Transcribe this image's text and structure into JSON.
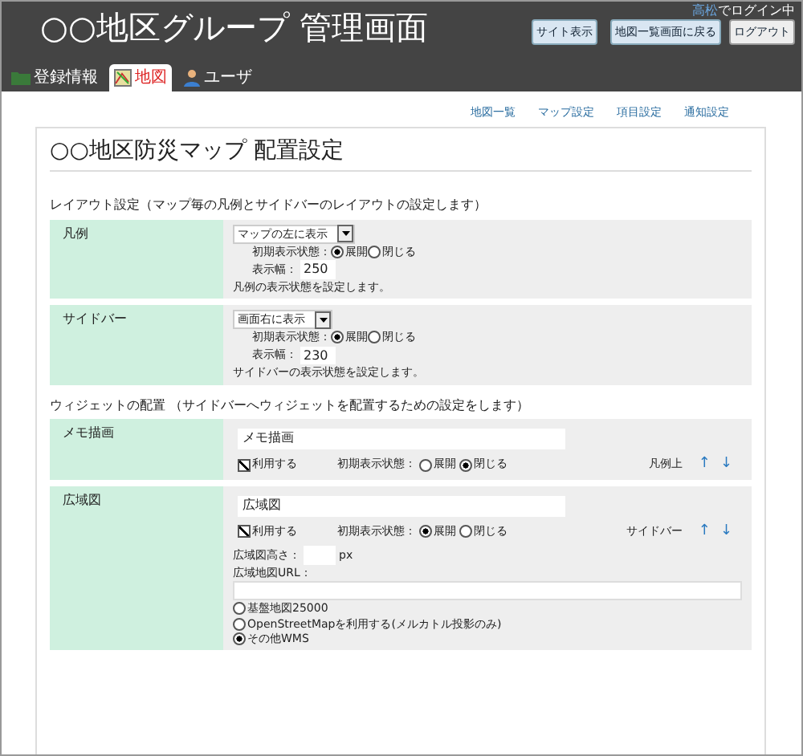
{
  "header": {
    "title": "○○地区グループ 管理画面",
    "login": {
      "user": "高松",
      "suffix": "でログイン中"
    },
    "buttons": [
      "サイト表示",
      "地図一覧画面に戻る",
      "ログアウト"
    ]
  },
  "tabs": [
    {
      "label": "登録情報",
      "selected": false
    },
    {
      "label": "地図",
      "selected": true
    },
    {
      "label": "ユーザ",
      "selected": false
    }
  ],
  "submenu": [
    "地図一覧",
    "マップ設定",
    "項目設定",
    "通知設定"
  ],
  "page_title": "○○地区防災マップ 配置設定",
  "sections": [
    {
      "heading": "レイアウト設定（マップ毎の凡例とサイドバーのレイアウトの設定します）",
      "rows": [
        {
          "kind": "layout",
          "label": "凡例",
          "select": "マップの左に表示",
          "state_label": "初期表示状態：",
          "options": [
            {
              "label": "展開",
              "selected": true
            },
            {
              "label": "閉じる",
              "selected": false
            }
          ],
          "width_label": "表示幅：",
          "width_value": "250",
          "note": "凡例の表示状態を設定します。"
        },
        {
          "kind": "layout",
          "label": "サイドバー",
          "select": "画面右に表示",
          "state_label": "初期表示状態：",
          "options": [
            {
              "label": "展開",
              "selected": true
            },
            {
              "label": "閉じる",
              "selected": false
            }
          ],
          "width_label": "表示幅：",
          "width_value": "230",
          "note": "サイドバーの表示状態を設定します。"
        }
      ]
    },
    {
      "heading": "ウィジェットの配置 （サイドバーへウィジェットを配置するための設定をします）",
      "rows": [
        {
          "kind": "widget",
          "label": "メモ描画",
          "name": "メモ描画",
          "use": {
            "label": "利用する",
            "checked": true
          },
          "state_label": "初期表示状態：",
          "options": [
            {
              "label": "展開",
              "selected": false
            },
            {
              "label": "閉じる",
              "selected": true
            }
          ],
          "position": "凡例上",
          "up": "↑",
          "down": "↓"
        },
        {
          "kind": "widget",
          "label": "広域図",
          "name": "広域図",
          "use": {
            "label": "利用する",
            "checked": true
          },
          "state_label": "初期表示状態：",
          "options": [
            {
              "label": "展開",
              "selected": true
            },
            {
              "label": "閉じる",
              "selected": false
            }
          ],
          "position": "サイドバー",
          "up": "↑",
          "down": "↓",
          "height_label": "広域図高さ：",
          "unit": "px",
          "url_label": "広域地図URL：",
          "sources": [
            {
              "label": "基盤地図25000",
              "selected": false
            },
            {
              "label": "OpenStreetMapを利用する(メルカトル投影のみ)",
              "selected": false
            },
            {
              "label": "その他WMS",
              "selected": true
            }
          ]
        }
      ]
    }
  ]
}
